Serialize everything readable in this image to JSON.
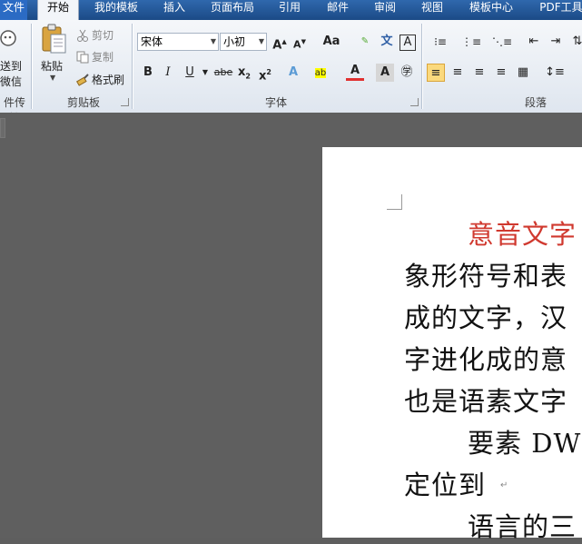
{
  "tabs": [
    "文件",
    "开始",
    "我的模板",
    "插入",
    "页面布局",
    "引用",
    "邮件",
    "审阅",
    "视图",
    "模板中心",
    "PDF工具"
  ],
  "ribbon": {
    "send_group": {
      "line1": "送到",
      "line2": "微信",
      "label": "件传输"
    },
    "clipboard": {
      "paste": "粘贴",
      "cut": "剪切",
      "copy": "复制",
      "format_painter": "格式刷",
      "label": "剪贴板"
    },
    "font": {
      "name": "宋体",
      "size": "小初",
      "label": "字体",
      "case_btn": "Aa"
    },
    "paragraph": {
      "label": "段落"
    }
  },
  "document": {
    "lines": [
      {
        "text": "意音文字",
        "red": true
      },
      {
        "text": "象形符号和表",
        "red": false
      },
      {
        "text": "成的文字，汉",
        "red": false
      },
      {
        "text": "字进化成的意",
        "red": false
      },
      {
        "text": "也是语素文字",
        "red": false
      },
      {
        "text": "要素 DW",
        "red": false
      },
      {
        "text": "定位到",
        "red": false
      },
      {
        "text": "语言的三",
        "red": false
      }
    ]
  },
  "colors": {
    "accent": "#1e4f8c",
    "doc_red": "#d0392f",
    "workspace": "#5f5f5f"
  }
}
